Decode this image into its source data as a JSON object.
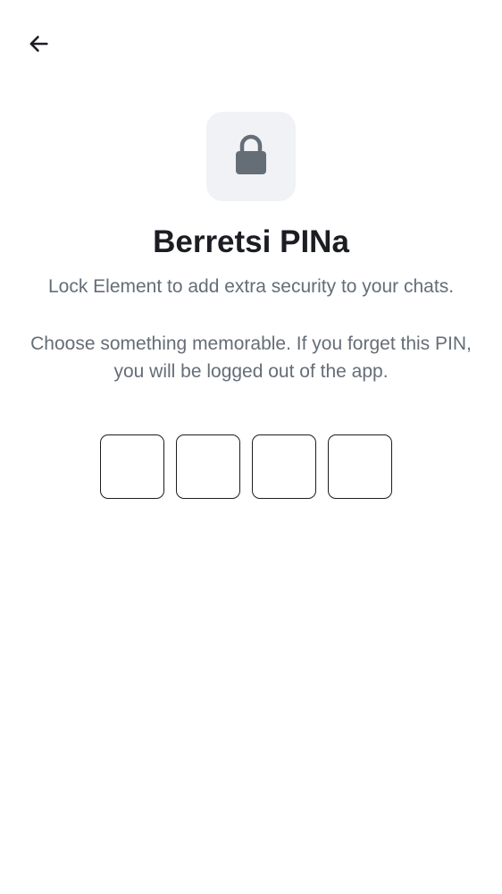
{
  "header": {
    "back_icon": "arrow-left-icon"
  },
  "hero": {
    "icon": "lock-icon",
    "tile_color": "#f0f2f5",
    "icon_color": "#656d77"
  },
  "title": "Berretsi PINa",
  "subtitle": "Lock Element to add extra security to your chats.",
  "info": "Choose something memorable. If you forget this PIN, you will be logged out of the app.",
  "pin": {
    "digits": [
      "",
      "",
      "",
      ""
    ]
  },
  "colors": {
    "text_primary": "#1b1d22",
    "text_secondary": "#656d77",
    "background": "#ffffff"
  }
}
